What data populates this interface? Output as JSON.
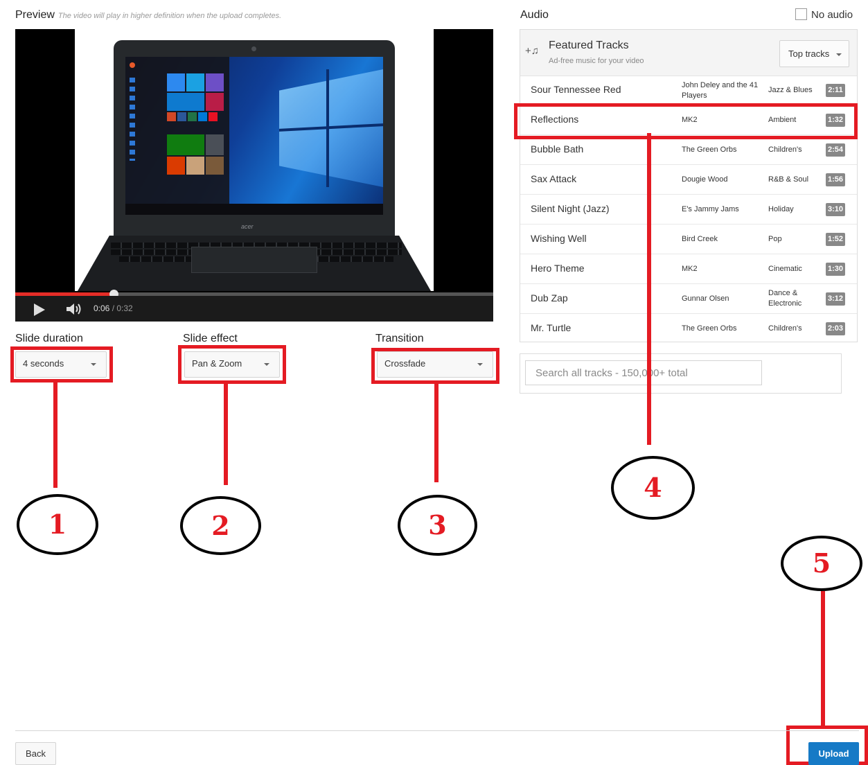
{
  "preview": {
    "title": "Preview",
    "note": "The video will play in higher definition when the upload completes.",
    "laptop_brand": "acer",
    "time_current": "0:06",
    "time_total": "/ 0:32",
    "progress_fraction": 0.206
  },
  "options": {
    "slide_duration": {
      "label": "Slide duration",
      "value": "4 seconds"
    },
    "slide_effect": {
      "label": "Slide effect",
      "value": "Pan & Zoom"
    },
    "transition": {
      "label": "Transition",
      "value": "Crossfade"
    }
  },
  "audio": {
    "title": "Audio",
    "no_audio_label": "No audio",
    "featured_title": "Featured Tracks",
    "featured_subtitle": "Ad-free music for your video",
    "top_tracks_label": "Top tracks",
    "tracks": [
      {
        "title": "Sour Tennessee Red",
        "artist": "John Deley and the 41 Players",
        "genre": "Jazz & Blues",
        "duration": "2:11"
      },
      {
        "title": "Reflections",
        "artist": "MK2",
        "genre": "Ambient",
        "duration": "1:32"
      },
      {
        "title": "Bubble Bath",
        "artist": "The Green Orbs",
        "genre": "Children's",
        "duration": "2:54"
      },
      {
        "title": "Sax Attack",
        "artist": "Dougie Wood",
        "genre": "R&B & Soul",
        "duration": "1:56"
      },
      {
        "title": "Silent Night (Jazz)",
        "artist": "E's Jammy Jams",
        "genre": "Holiday",
        "duration": "3:10"
      },
      {
        "title": "Wishing Well",
        "artist": "Bird Creek",
        "genre": "Pop",
        "duration": "1:52"
      },
      {
        "title": "Hero Theme",
        "artist": "MK2",
        "genre": "Cinematic",
        "duration": "1:30"
      },
      {
        "title": "Dub Zap",
        "artist": "Gunnar Olsen",
        "genre": "Dance & Electronic",
        "duration": "3:12"
      },
      {
        "title": "Mr. Turtle",
        "artist": "The Green Orbs",
        "genre": "Children's",
        "duration": "2:03"
      }
    ],
    "search_placeholder": "Search all tracks - 150,000+ total"
  },
  "annotations": [
    "1",
    "2",
    "3",
    "4",
    "5"
  ],
  "footer": {
    "back_label": "Back",
    "upload_label": "Upload"
  },
  "colors": {
    "annotation_red": "#e41b23",
    "upload_blue": "#167ac6",
    "progress_red": "#e52d27"
  },
  "icons": [
    "play-icon",
    "volume-icon",
    "add-music-icon",
    "chevron-down-icon",
    "checkbox-icon"
  ]
}
